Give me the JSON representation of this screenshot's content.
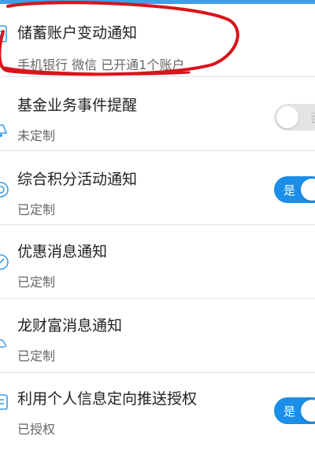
{
  "colors": {
    "accent": "#1a8ee8",
    "annotation": "#d9141c",
    "toggle_off": "#e4e4e4"
  },
  "items": [
    {
      "title": "储蓄账户变动通知",
      "subtitle": "手机银行 微信 已开通1个账户",
      "icon": "document-icon",
      "toggle": null
    },
    {
      "title": "基金业务事件提醒",
      "subtitle": "未定制",
      "icon": "fund-bell-icon",
      "toggle": {
        "state": "off",
        "label": "否"
      }
    },
    {
      "title": "综合积分活动通知",
      "subtitle": "已定制",
      "icon": "points-icon",
      "toggle": {
        "state": "on",
        "label": "是"
      }
    },
    {
      "title": "优惠消息通知",
      "subtitle": "已定制",
      "icon": "discount-icon",
      "toggle": null
    },
    {
      "title": "龙财富消息通知",
      "subtitle": "已定制",
      "icon": "wealth-icon",
      "toggle": null
    },
    {
      "title": "利用个人信息定向推送授权",
      "subtitle": "已授权",
      "icon": "authorization-icon",
      "toggle": {
        "state": "on",
        "label": "是"
      }
    }
  ]
}
